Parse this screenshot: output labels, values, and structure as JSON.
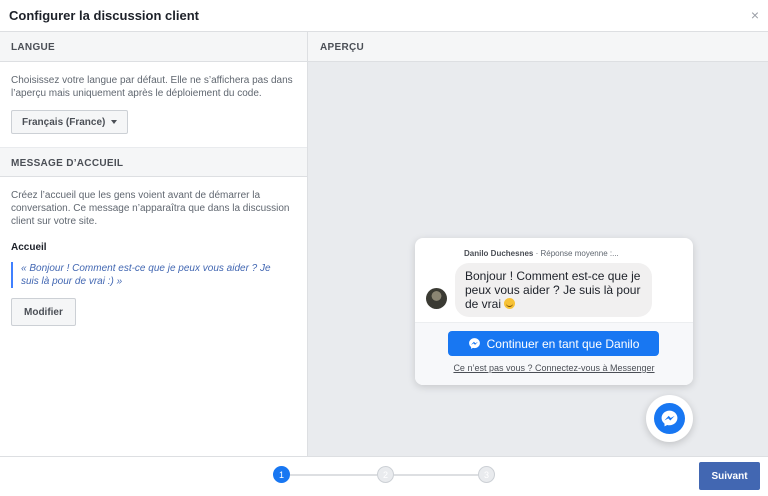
{
  "dialog": {
    "title": "Configurer la discussion client",
    "close_symbol": "×"
  },
  "language": {
    "heading": "LANGUE",
    "description": "Choisissez votre langue par défaut. Elle ne s’affichera pas dans l’aperçu mais uniquement après le déploiement du code.",
    "selected": "Français (France)"
  },
  "welcome": {
    "heading": "MESSAGE D’ACCUEIL",
    "description": "Créez l’accueil que les gens voient avant de démarrer la conversation. Ce message n’apparaîtra que dans la discussion client sur votre site.",
    "label": "Accueil",
    "quote": "« Bonjour ! Comment est-ce que je peux vous aider ? Je suis là pour de vrai :) »",
    "modify_label": "Modifier"
  },
  "preview": {
    "heading": "APERÇU",
    "sender_name": "Danilo Duchesnes",
    "response_time": "· Réponse moyenne :...",
    "message": "Bonjour ! Comment est-ce que je peux vous aider ? Je suis là pour de vrai",
    "continue_label": "Continuer en tant que Danilo",
    "other_user_link": "Ce n’est pas vous ? Connectez-vous à Messenger"
  },
  "footer": {
    "steps": [
      "1",
      "2",
      "3"
    ],
    "active_step": 1,
    "next_label": "Suivant"
  },
  "colors": {
    "messenger_blue": "#1877f2",
    "primary_button": "#4267b2",
    "quote_border": "#4080ff"
  },
  "icons": {
    "close": "close-icon",
    "dropdown": "caret-down-icon",
    "messenger": "messenger-icon",
    "emoji": "smiley-emoji-icon"
  }
}
